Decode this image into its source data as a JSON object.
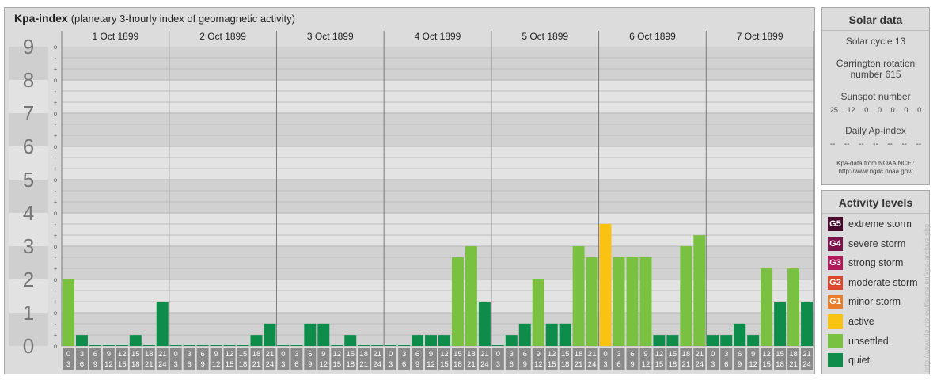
{
  "header": {
    "title_bold": "Kpa-index",
    "title_rest": "(planetary 3-hourly index of geomagnetic activity)"
  },
  "chart_data": {
    "type": "bar",
    "title": "Kpa-index",
    "subtitle": "(planetary 3-hourly index of geomagnetic activity)",
    "ylim": [
      0,
      9
    ],
    "yticks": [
      "0",
      "1",
      "2",
      "3",
      "4",
      "5",
      "6",
      "7",
      "8",
      "9"
    ],
    "minor_ticks": [
      "o",
      "+",
      "-"
    ],
    "days": [
      "1 Oct 1899",
      "2 Oct 1899",
      "3 Oct 1899",
      "4 Oct 1899",
      "5 Oct 1899",
      "6 Oct 1899",
      "7 Oct 1899"
    ],
    "interval_start": [
      "0",
      "3",
      "6",
      "9",
      "12",
      "15",
      "18",
      "21"
    ],
    "interval_end": [
      "3",
      "6",
      "9",
      "12",
      "15",
      "18",
      "21",
      "24"
    ],
    "values": [
      [
        2.0,
        0.33,
        0,
        0,
        0,
        0.33,
        0,
        1.33
      ],
      [
        0,
        0,
        0,
        0,
        0,
        0,
        0.33,
        0.67
      ],
      [
        0,
        0,
        0.67,
        0.67,
        0,
        0.33,
        0,
        0
      ],
      [
        0,
        0,
        0.33,
        0.33,
        0.33,
        2.67,
        3.0,
        1.33
      ],
      [
        0,
        0.33,
        0.67,
        2.0,
        0.67,
        0.67,
        3.0,
        2.67
      ],
      [
        3.67,
        2.67,
        2.67,
        2.67,
        0.33,
        0.33,
        3.0,
        3.33
      ],
      [
        0.33,
        0.33,
        0.67,
        0.33,
        2.33,
        1.33,
        2.33,
        1.33
      ]
    ],
    "colors": {
      "quiet": "#0e8c4a",
      "unsettled": "#7ac142",
      "active": "#fbc311",
      "minor": "#e87d2c",
      "moderate": "#d9462c",
      "strong": "#b0185a",
      "severe": "#7d1149",
      "extreme": "#4a0a2d"
    }
  },
  "solar": {
    "title": "Solar data",
    "cycle": "Solar cycle 13",
    "carrington_line1": "Carrington rotation",
    "carrington_line2": "number 615",
    "sunspot_title": "Sunspot number",
    "sunspots": [
      "25",
      "12",
      "0",
      "0",
      "0",
      "0",
      "0"
    ],
    "ap_title": "Daily Ap-index",
    "ap": [
      "--",
      "--",
      "--",
      "--",
      "--",
      "--",
      "--"
    ],
    "credit1": "Kpa-data from NOAA NCEI:",
    "credit2": "http://www.ngdc.noaa.gov/"
  },
  "levels": {
    "title": "Activity levels",
    "items": [
      {
        "badge": "G5",
        "label": "extreme storm",
        "color": "#4a0a2d"
      },
      {
        "badge": "G4",
        "label": "severe storm",
        "color": "#7d1149"
      },
      {
        "badge": "G3",
        "label": "strong storm",
        "color": "#b0185a"
      },
      {
        "badge": "G2",
        "label": "moderate storm",
        "color": "#d9462c"
      },
      {
        "badge": "G1",
        "label": "minor storm",
        "color": "#e87d2c"
      },
      {
        "badge": "",
        "label": "active",
        "color": "#fbc311"
      },
      {
        "badge": "",
        "label": "unsettled",
        "color": "#7ac142"
      },
      {
        "badge": "",
        "label": "quiet",
        "color": "#0e8c4a"
      }
    ]
  },
  "watermark": "http://www.fleurie.eu/fleurie.eu/kpa-archive.php"
}
